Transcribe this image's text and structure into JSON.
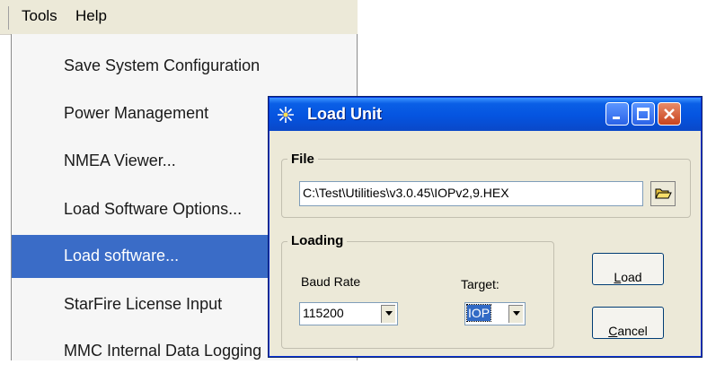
{
  "menubar": {
    "tools_label": "Tools",
    "help_label": "Help"
  },
  "dropdown": {
    "items": [
      {
        "label": "Save System Configuration"
      },
      {
        "label": "Power Management"
      },
      {
        "label": "NMEA Viewer..."
      },
      {
        "label": "Load Software Options..."
      },
      {
        "label": "Load software..."
      },
      {
        "label": "StarFire License Input"
      },
      {
        "label": "MMC Internal Data Logging"
      }
    ],
    "highlighted_index": 4,
    "highlight_color": "#3a6cc7"
  },
  "dialog": {
    "title": "Load Unit",
    "file_group_label": "File",
    "file_path": "C:\\Test\\Utilities\\v3.0.45\\IOPv2,9.HEX",
    "loading_group_label": "Loading",
    "baud_rate_label": "Baud Rate",
    "baud_rate_value": "115200",
    "target_label": "Target:",
    "target_value": "IOP",
    "load_button": {
      "mnemonic": "L",
      "rest": "oad"
    },
    "cancel_button": {
      "mnemonic": "C",
      "rest": "ancel"
    },
    "title_bar_color": "#0554e0",
    "body_color": "#ece9d8"
  }
}
